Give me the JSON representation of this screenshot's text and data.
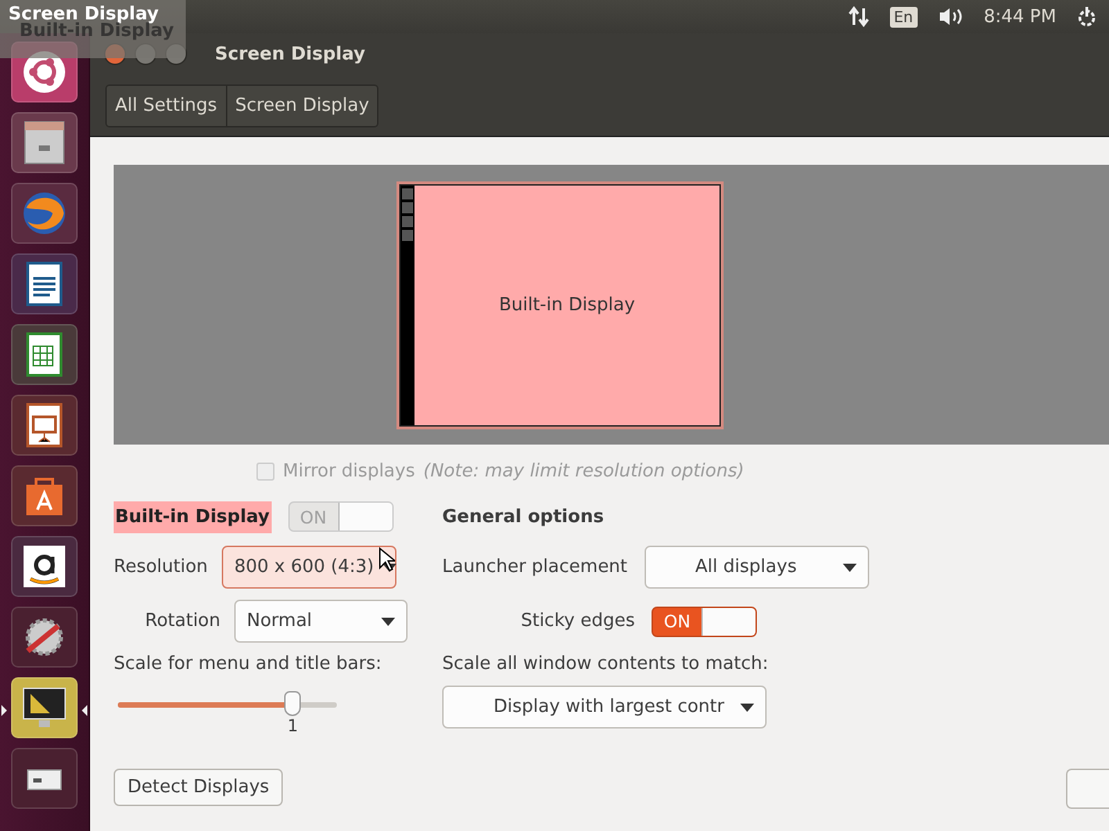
{
  "top_panel": {
    "language": "En",
    "clock": "8:44 PM"
  },
  "overlay": {
    "title": "Screen Display",
    "subtitle": "Built-in Display"
  },
  "launcher": {
    "items": [
      {
        "kind": "ubuntu",
        "selected": false
      },
      {
        "kind": "files",
        "selected": false
      },
      {
        "kind": "browser",
        "selected": false
      },
      {
        "kind": "writer",
        "selected": false
      },
      {
        "kind": "calc",
        "selected": false
      },
      {
        "kind": "impress",
        "selected": false
      },
      {
        "kind": "software",
        "selected": false
      },
      {
        "kind": "amazon",
        "selected": false
      },
      {
        "kind": "settings",
        "selected": false
      },
      {
        "kind": "display",
        "selected": true
      },
      {
        "kind": "drive",
        "selected": false
      }
    ]
  },
  "window": {
    "title": "Screen Display",
    "breadcrumbs": [
      "All Settings",
      "Screen Display"
    ]
  },
  "monitor": {
    "label": "Built-in Display"
  },
  "mirror": {
    "label": "Mirror displays",
    "note": "(Note: may limit resolution options)",
    "checked": false,
    "disabled": true
  },
  "display": {
    "name": "Built-in Display",
    "switch_label": "ON",
    "on": true,
    "disabled": true,
    "resolution": {
      "label": "Resolution",
      "value": "800 x 600 (4:3)",
      "hover": true
    },
    "rotation": {
      "label": "Rotation",
      "value": "Normal"
    },
    "scale": {
      "label": "Scale for menu and title bars:",
      "level": 0.8,
      "reading": "1"
    }
  },
  "general": {
    "heading": "General options",
    "launcher_placement": {
      "label": "Launcher placement",
      "value": "All displays"
    },
    "sticky_edges": {
      "label": "Sticky edges",
      "switch_label": "ON",
      "on": true,
      "disabled": false
    },
    "scale_all": {
      "label": "Scale all window contents to match:",
      "value": "Display with largest contr"
    }
  },
  "buttons": [
    {
      "label": "Detect Displays"
    }
  ]
}
